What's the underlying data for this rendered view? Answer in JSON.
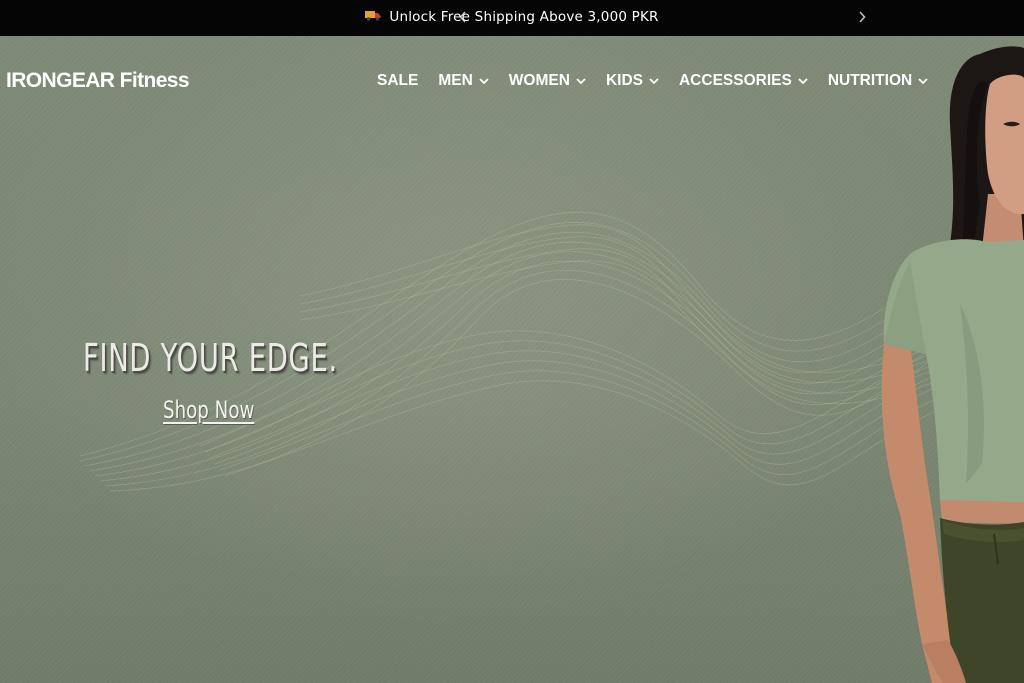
{
  "announcement": {
    "icon": "truck-icon",
    "text": "Unlock Free Shipping Above 3,000 PKR"
  },
  "brand": {
    "logo": "IRONGEAR Fitness"
  },
  "nav": {
    "items": [
      {
        "label": "SALE",
        "dropdown": false
      },
      {
        "label": "MEN",
        "dropdown": true
      },
      {
        "label": "WOMEN",
        "dropdown": true
      },
      {
        "label": "KIDS",
        "dropdown": true
      },
      {
        "label": "ACCESSORIES",
        "dropdown": true
      },
      {
        "label": "NUTRITION",
        "dropdown": true
      }
    ]
  },
  "hero": {
    "headline": "FIND YOUR EDGE.",
    "cta": "Shop Now"
  },
  "colors": {
    "announcement_bg": "#050505",
    "hero_bg": "#7f8a76",
    "text": "#ffffff",
    "top_garment": "#93a98a",
    "bottom_garment": "#3f4528"
  }
}
